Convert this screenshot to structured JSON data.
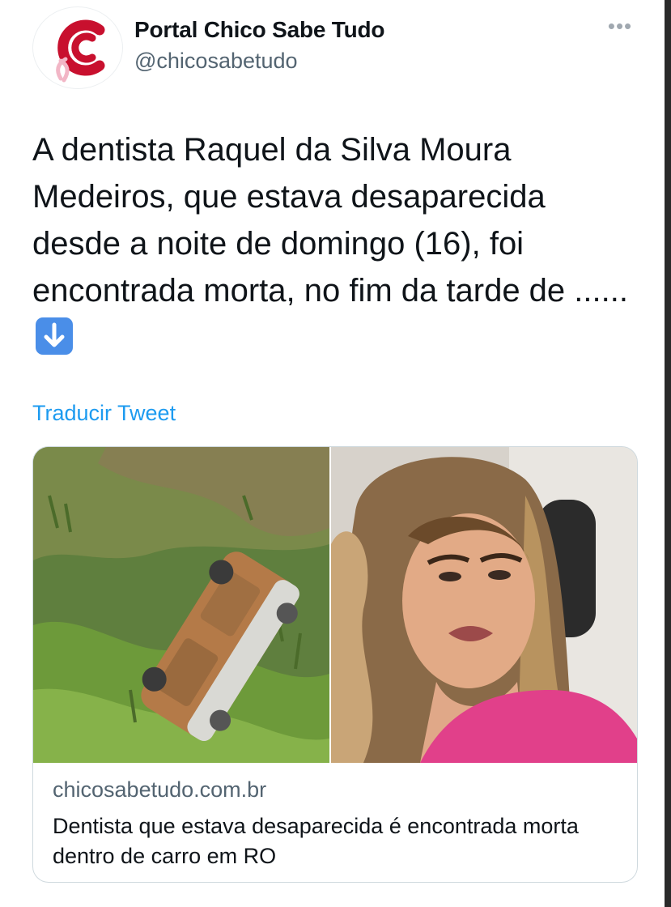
{
  "tweet": {
    "author_name": "Portal Chico Sabe Tudo",
    "author_handle": "@chicosabetudo",
    "more_label": "•••",
    "text": "A dentista Raquel da Silva Moura Medeiros, que estava desaparecida desde a noite de domingo (16), foi encontrada morta, no fim da tarde de ......",
    "emoji_icon": "down-arrow-emoji",
    "translate_label": "Traducir Tweet"
  },
  "link_card": {
    "domain": "chicosabetudo.com.br",
    "title": "Dentista que estava desaparecida é encontrada morta dentro de carro em RO"
  },
  "colors": {
    "brand_red": "#c8102e",
    "link_blue": "#1d9bf0",
    "secondary_text": "#536471",
    "border": "#cfd9de"
  }
}
